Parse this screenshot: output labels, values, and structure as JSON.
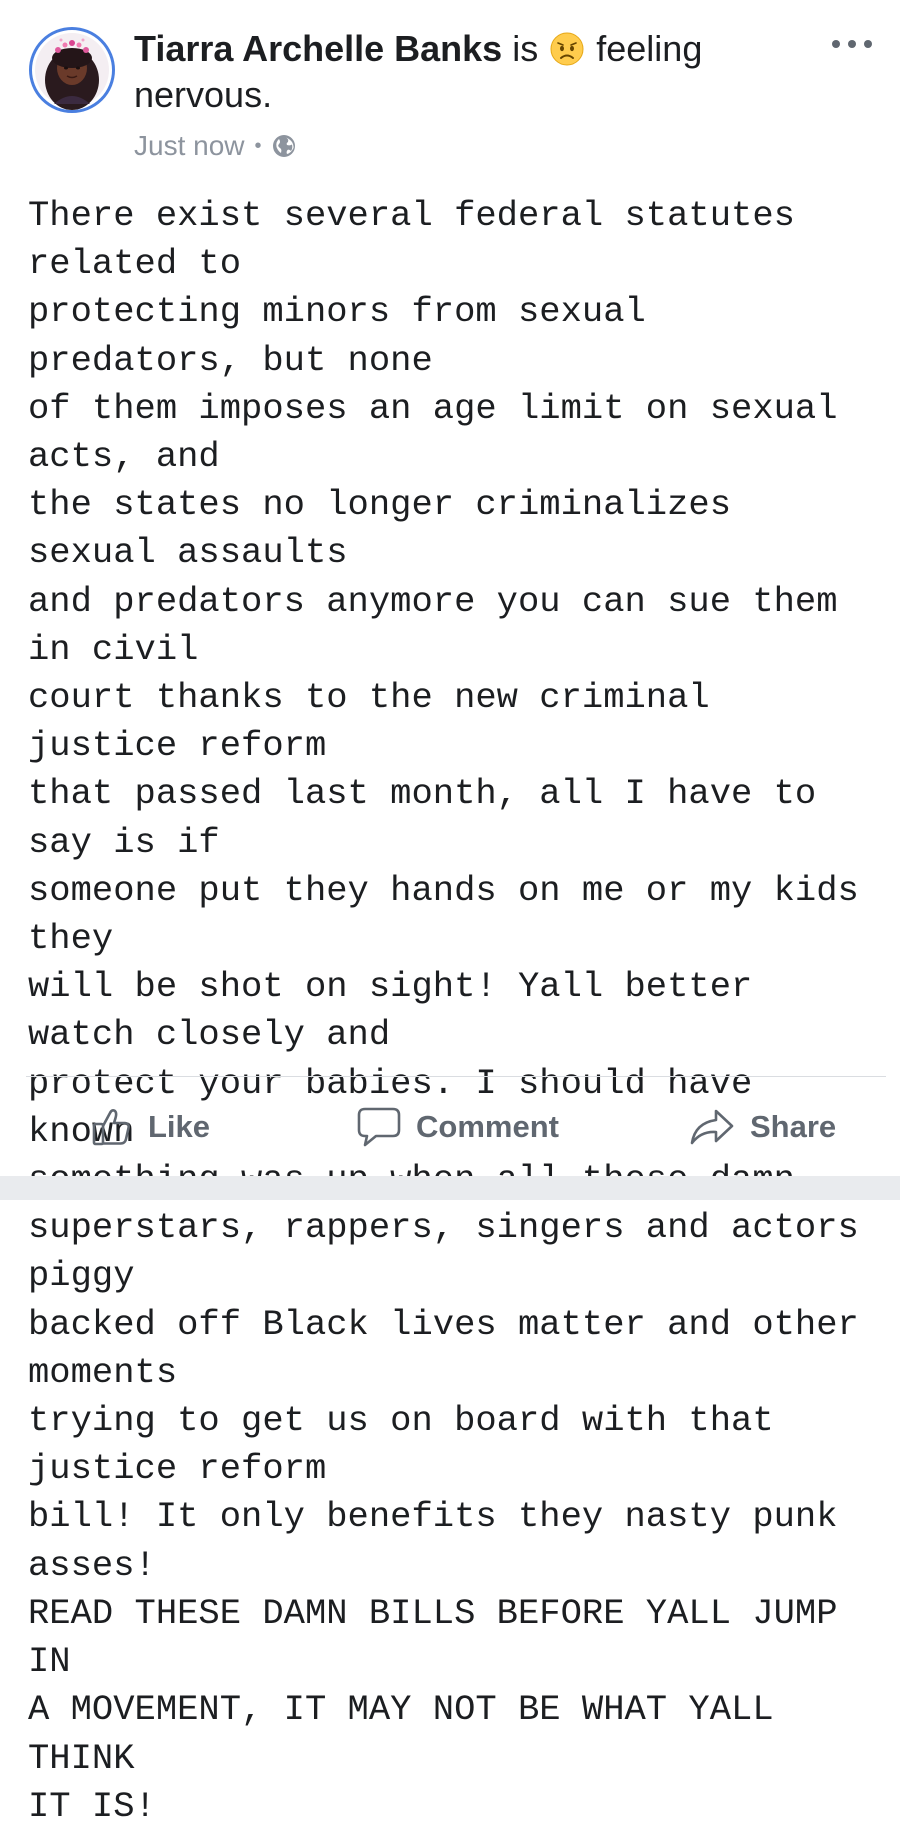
{
  "post": {
    "author": "Tiarra Archelle Banks",
    "feeling_prefix": "is",
    "feeling_emoji_icon": "worried-face-emoji",
    "feeling_text": "feeling nervous.",
    "timestamp": "Just now",
    "separator": "•",
    "privacy_icon": "globe-icon",
    "body": "There exist several federal statutes related to\nprotecting minors from sexual predators, but none\nof them imposes an age limit on sexual acts, and\nthe states no longer criminalizes sexual assaults\nand predators anymore you can sue them in civil\ncourt thanks to the new criminal justice reform\nthat passed last month, all I have to say is if\nsomeone put they hands on me or my kids they\nwill be shot on sight! Yall better watch closely and\nprotect your babies. I should have known\nsomething was up when all these damn\nsuperstars, rappers, singers and actors piggy\nbacked off Black lives matter and other moments\ntrying to get us on board with that justice reform\nbill! It only benefits they nasty punk asses!\nREAD THESE DAMN BILLS BEFORE YALL JUMP IN\nA MOVEMENT, IT MAY NOT BE WHAT YALL THINK\nIT IS!"
  },
  "actions": {
    "like_label": "Like",
    "comment_label": "Comment",
    "share_label": "Share"
  },
  "colors": {
    "avatar_ring": "#4a7fe0",
    "meta_text": "#8d949e",
    "action_text": "#606770",
    "divider": "#dadde1"
  }
}
